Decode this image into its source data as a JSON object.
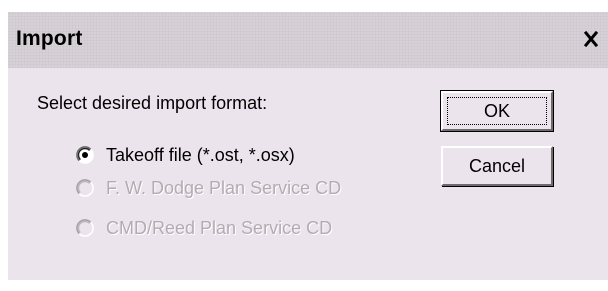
{
  "window": {
    "title": "Import"
  },
  "prompt": "Select desired import format:",
  "options": [
    {
      "label": "Takeoff file (*.ost, *.osx)",
      "selected": true,
      "enabled": true
    },
    {
      "label": "F. W. Dodge Plan Service CD",
      "selected": false,
      "enabled": false
    },
    {
      "label": "CMD/Reed Plan Service CD",
      "selected": false,
      "enabled": false
    }
  ],
  "buttons": {
    "ok_label": "OK",
    "cancel_label": "Cancel"
  },
  "colors": {
    "dialog_bg": "#ece4ec",
    "titlebar_bg": "#d9d3d9",
    "disabled_text": "#b2acb2"
  },
  "icons": {
    "close": "close-icon",
    "radio_selected": "radio-selected-icon",
    "radio_unselected": "radio-unselected-icon"
  }
}
